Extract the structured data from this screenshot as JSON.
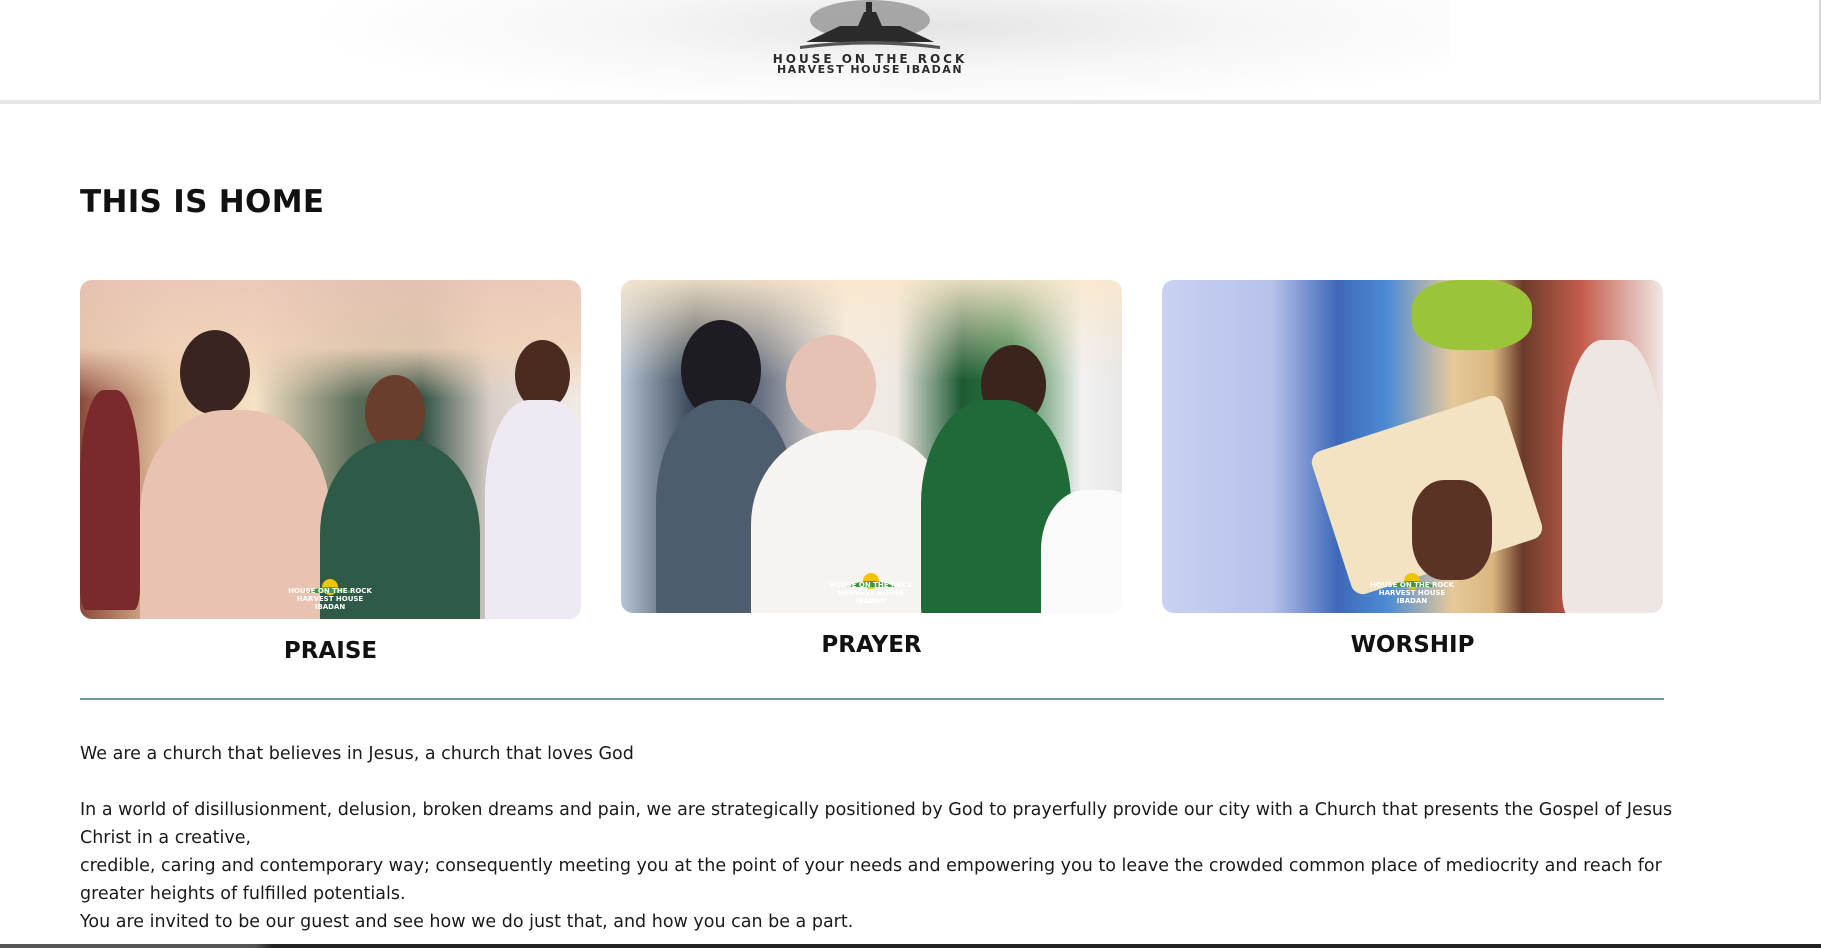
{
  "header": {
    "logo_line1": "HOUSE ON THE ROCK",
    "logo_line2": "HARVEST HOUSE IBADAN"
  },
  "main": {
    "title": "THIS IS HOME",
    "cards": [
      {
        "label": "PRAISE",
        "watermark": "HOUSE ON THE ROCK HARVEST HOUSE IBADAN"
      },
      {
        "label": "PRAYER",
        "watermark": "HOUSE ON THE ROCK HARVEST HOUSE IBADAN"
      },
      {
        "label": "WORSHIP",
        "watermark": "HOUSE ON THE ROCK HARVEST HOUSE IBADAN"
      }
    ],
    "paragraphs": {
      "intro": "We are a church that believes in Jesus, a church that loves God",
      "line1": "In a world of disillusionment, delusion, broken dreams and pain, we are strategically positioned by God to prayerfully provide our city with a Church that presents the Gospel of Jesus Christ in a creative,",
      "line2": "credible, caring and contemporary way; consequently meeting you at the point of your needs and empowering you to leave the crowded common place of mediocrity and reach for greater heights of fulfilled potentials.",
      "line3": "You are invited to be our guest and see how we do just that, and how you can be a part."
    }
  },
  "colors": {
    "divider": "#6f9a96",
    "text": "#111111",
    "header_border": "#e6e6e6"
  }
}
